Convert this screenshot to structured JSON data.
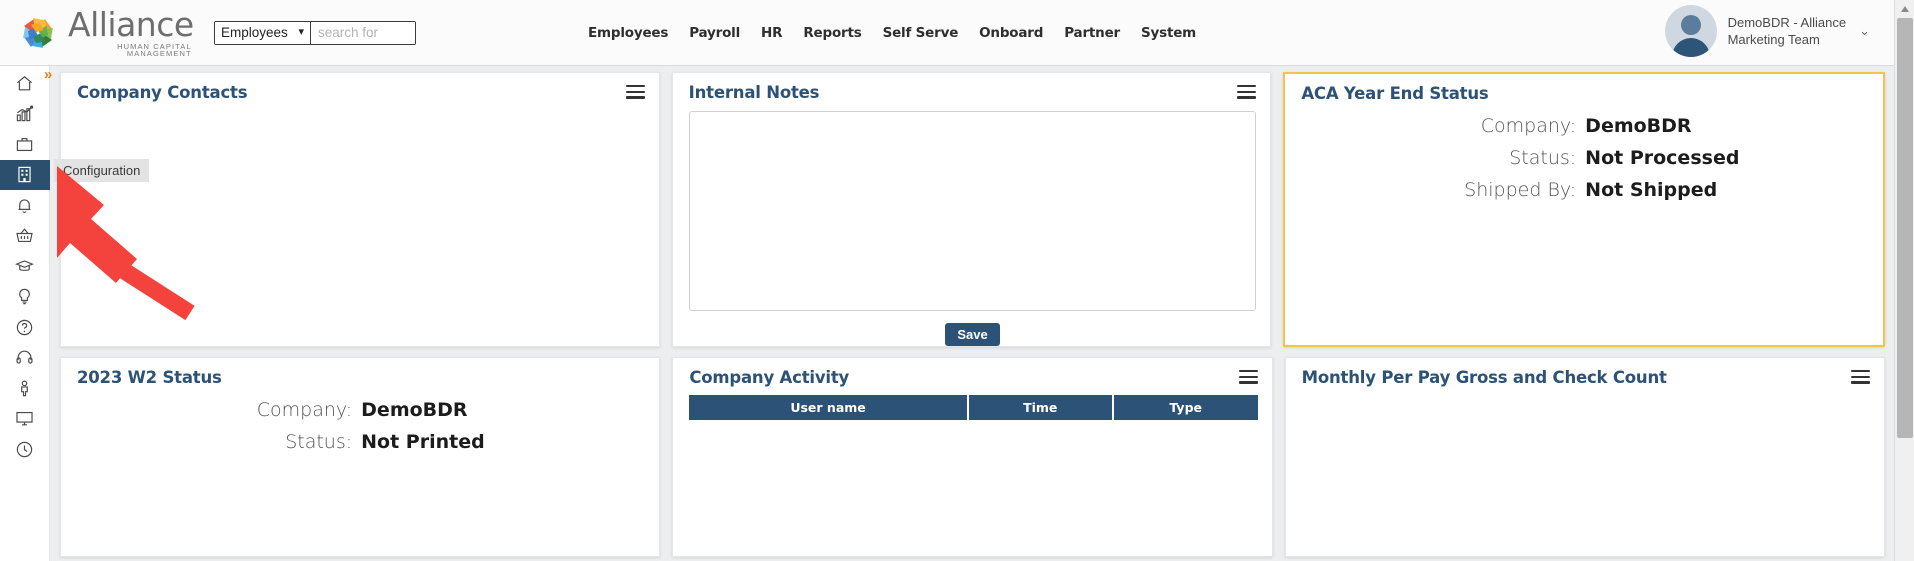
{
  "brand": {
    "name": "Alliance",
    "tagline": "HUMAN CAPITAL MANAGEMENT",
    "logo_icon": "alliance-star-logo"
  },
  "search": {
    "selected_scope": "Employees",
    "scope_options": [
      "Employees"
    ],
    "placeholder": "search for",
    "value": ""
  },
  "mainnav": {
    "items": [
      {
        "label": "Employees"
      },
      {
        "label": "Payroll"
      },
      {
        "label": "HR"
      },
      {
        "label": "Reports"
      },
      {
        "label": "Self Serve"
      },
      {
        "label": "Onboard"
      },
      {
        "label": "Partner"
      },
      {
        "label": "System"
      }
    ]
  },
  "user": {
    "line1": "DemoBDR - Alliance",
    "line2": "Marketing Team",
    "caret": "⌄",
    "avatar_icon": "user-avatar-icon"
  },
  "rail": {
    "expand_chevron": "»",
    "items": [
      {
        "name": "home",
        "icon": "home-icon",
        "active": false
      },
      {
        "name": "analytics",
        "icon": "bar-chart-icon",
        "active": false
      },
      {
        "name": "briefcase",
        "icon": "briefcase-icon",
        "active": false
      },
      {
        "name": "configuration",
        "icon": "building-icon",
        "active": true
      },
      {
        "name": "notifications",
        "icon": "bell-icon",
        "active": false
      },
      {
        "name": "marketplace",
        "icon": "basket-icon",
        "active": false
      },
      {
        "name": "learning",
        "icon": "graduation-cap-icon",
        "active": false
      },
      {
        "name": "ideas",
        "icon": "lightbulb-icon",
        "active": false
      },
      {
        "name": "help",
        "icon": "question-circle-icon",
        "active": false
      },
      {
        "name": "support",
        "icon": "headset-icon",
        "active": false
      },
      {
        "name": "person",
        "icon": "person-icon",
        "active": false
      },
      {
        "name": "desktop",
        "icon": "monitor-icon",
        "active": false
      },
      {
        "name": "time",
        "icon": "clock-icon",
        "active": false
      }
    ]
  },
  "tooltip": {
    "text": "Configuration"
  },
  "cards": {
    "company_contacts": {
      "title": "Company Contacts",
      "menu_icon": "hamburger-menu-icon"
    },
    "internal_notes": {
      "title": "Internal Notes",
      "menu_icon": "hamburger-menu-icon",
      "textarea_value": "",
      "save_label": "Save"
    },
    "aca_year_end": {
      "title": "ACA Year End Status",
      "accent_color": "#f6c445",
      "rows": [
        {
          "label": "Company:",
          "value": "DemoBDR"
        },
        {
          "label": "Status:",
          "value": "Not Processed"
        },
        {
          "label": "Shipped By:",
          "value": "Not Shipped"
        }
      ]
    },
    "w2_status": {
      "title": "2023 W2 Status",
      "rows": [
        {
          "label": "Company:",
          "value": "DemoBDR"
        },
        {
          "label": "Status:",
          "value": "Not Printed"
        }
      ]
    },
    "company_activity": {
      "title": "Company Activity",
      "menu_icon": "hamburger-menu-icon",
      "columns": [
        "User name",
        "Time",
        "Type"
      ],
      "rows": []
    },
    "monthly_gross": {
      "title": "Monthly Per Pay Gross and Check Count",
      "menu_icon": "hamburger-menu-icon"
    }
  },
  "colors": {
    "brand_blue": "#2d5277",
    "accent_orange": "#f07d22",
    "accent_yellow": "#f6c445",
    "annotation_red": "#f4433c"
  }
}
